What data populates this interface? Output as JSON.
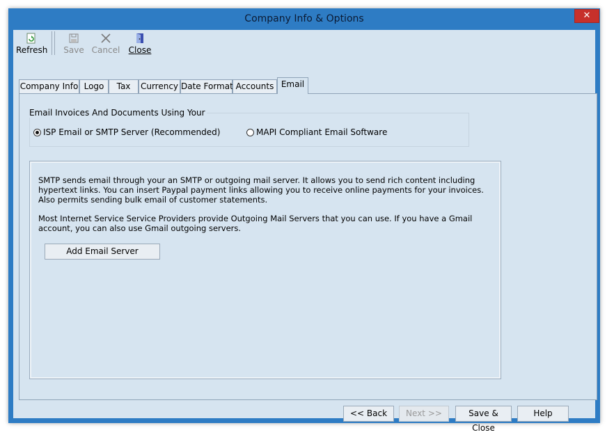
{
  "window": {
    "title": "Company Info & Options",
    "close_label": "✕"
  },
  "toolbar": {
    "refresh": {
      "label": "Refresh",
      "enabled": true
    },
    "save": {
      "label": "Save",
      "enabled": false
    },
    "cancel": {
      "label": "Cancel",
      "enabled": false
    },
    "close": {
      "label": "Close",
      "enabled": true
    }
  },
  "tabs": [
    {
      "label": "Company Info"
    },
    {
      "label": "Logo"
    },
    {
      "label": "Tax"
    },
    {
      "label": "Currency"
    },
    {
      "label": "Date Format"
    },
    {
      "label": "Accounts"
    },
    {
      "label": "Email",
      "active": true
    }
  ],
  "email": {
    "group_title": "Email Invoices And Documents Using Your",
    "options": [
      {
        "label": "ISP Email or SMTP Server (Recommended)",
        "selected": true
      },
      {
        "label": "MAPI Compliant Email Software",
        "selected": false
      }
    ],
    "info_paragraph_1": "SMTP sends email through your an SMTP or outgoing mail server. It allows you to send rich content including hypertext links. You can insert Paypal payment links allowing you to receive online payments for your invoices. Also permits sending bulk email of customer statements.",
    "info_paragraph_2": "Most Internet Service Service Providers provide Outgoing Mail Servers that you can use. If you have a Gmail account, you can also use Gmail outgoing servers.",
    "add_server_label": "Add Email Server"
  },
  "footer": {
    "back": {
      "label": "<< Back",
      "enabled": true
    },
    "next": {
      "label": "Next >>",
      "enabled": false
    },
    "save_close": {
      "label": "Save & Close",
      "enabled": true
    },
    "help": {
      "label": "Help",
      "enabled": true
    }
  }
}
